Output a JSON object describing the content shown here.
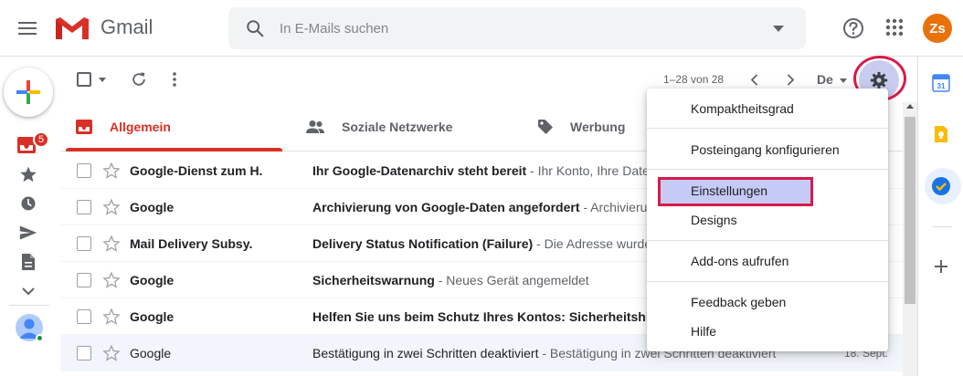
{
  "app": {
    "name": "Gmail",
    "brand_color": "#d93025",
    "accent_ring_color": "#d81b4a"
  },
  "header": {
    "search": {
      "placeholder": "In E-Mails suchen"
    },
    "avatar_initials": "Zs",
    "icons": [
      "main-menu-icon",
      "gmail-logo",
      "search-icon",
      "search-options-icon",
      "help-icon",
      "apps-grid-icon"
    ]
  },
  "left_rail": {
    "inbox_badge": "5",
    "icons": [
      "compose-icon",
      "inbox-icon",
      "starred-icon",
      "snoozed-icon",
      "sent-icon",
      "drafts-icon",
      "more-icon",
      "user-avatar-icon"
    ]
  },
  "toolbar": {
    "pagination": "1–28 von 28",
    "lang_label": "De",
    "icons": [
      "select-all-checkbox",
      "select-dropdown-icon",
      "refresh-icon",
      "more-vert-icon",
      "prev-page-icon",
      "next-page-icon",
      "settings-gear-icon"
    ]
  },
  "tabs": [
    {
      "label": "Allgemein",
      "icon": "inbox-tab-icon",
      "active": true
    },
    {
      "label": "Soziale Netzwerke",
      "icon": "people-icon",
      "active": false
    },
    {
      "label": "Werbung",
      "icon": "tag-icon",
      "active": false
    }
  ],
  "emails": [
    {
      "sender": "Google-Dienst zum H.",
      "subject": "Ihr Google-Datenarchiv steht bereit",
      "snippet": " - Ihr Konto, Ihre Daten",
      "date": "",
      "read": false
    },
    {
      "sender": "Google",
      "subject": "Archivierung von Google-Daten angefordert",
      "snippet": " - Archivierun",
      "date": "",
      "read": false
    },
    {
      "sender": "Mail Delivery Subsy.",
      "subject": "Delivery Status Notification (Failure)",
      "snippet": " - Die Adresse wurde",
      "date": "",
      "read": false
    },
    {
      "sender": "Google",
      "subject": "Sicherheitswarnung",
      "snippet": " - Neues Gerät angemeldet",
      "date": "",
      "read": false
    },
    {
      "sender": "Google",
      "subject": "Helfen Sie uns beim Schutz Ihres Kontos: Sicherheitshin",
      "snippet": "",
      "date": "",
      "read": false
    },
    {
      "sender": "Google",
      "subject": "Bestätigung in zwei Schritten deaktiviert",
      "snippet": " - Bestätigung in zwei Schritten deaktiviert",
      "date": "18. Sept.",
      "read": true
    }
  ],
  "settings_menu": {
    "items": [
      "Kompaktheitsgrad",
      "Posteingang konfigurieren",
      "Einstellungen",
      "Designs",
      "Add-ons aufrufen",
      "Feedback geben",
      "Hilfe"
    ],
    "highlighted": "Einstellungen"
  },
  "right_rail": {
    "icons": [
      "calendar-icon",
      "keep-icon",
      "tasks-icon",
      "add-addon-icon"
    ],
    "calendar_day": "31"
  }
}
